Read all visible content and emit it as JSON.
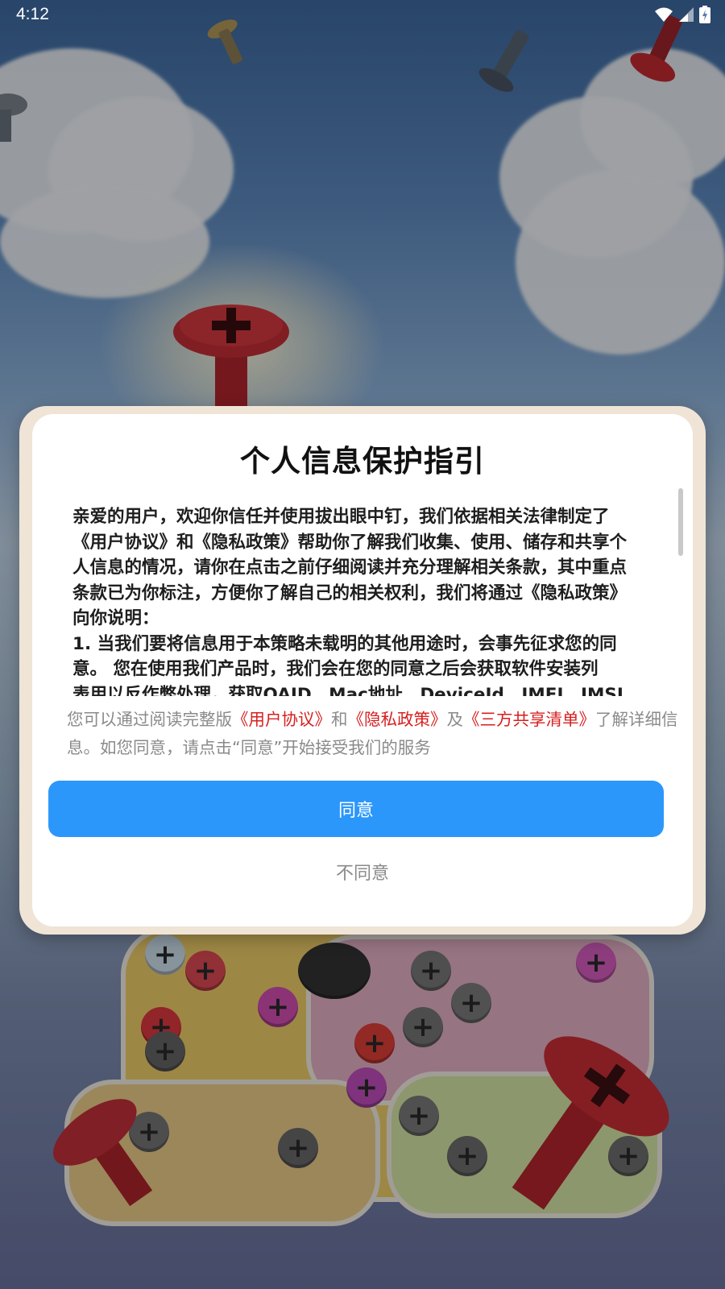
{
  "status_bar": {
    "time": "4:12",
    "icons": [
      "wifi-icon",
      "cellular-signal-icon",
      "battery-charging-icon"
    ]
  },
  "dialog": {
    "title": "个人信息保护指引",
    "terms_lines": [
      "亲爱的用户，欢迎你信任并使用拔出眼中钉，我们依据相关法律制定了",
      "《用户协议》和《隐私政策》帮助你了解我们收集、使用、储存和共享个",
      "人信息的情况，请你在点击之前仔细阅读并充分理解相关条款，其中重点",
      "条款已为你标注，方便你了解自己的相关权利，我们将通过《隐私政策》",
      "向你说明：",
      "1. 当我们要将信息用于本策略未载明的其他用途时，会事先征求您的同",
      "意。 您在使用我们产品时，我们会在您的同意之后会获取软件安装列",
      "表用以反作弊处理，获取OAID、Mac地址、DeviceId、IMEI、IMSI、"
    ],
    "summary": {
      "prefix": "您可以通过阅读完整版",
      "link_user_agreement": "《用户协议》",
      "and": "和",
      "link_privacy_policy": "《隐私政策》",
      "and2": "及",
      "link_third_party_list": "《三方共享清单》",
      "suffix": "了解详细信息。如您同意，请点击“同意”开始接受我们的服务"
    },
    "agree_label": "同意",
    "disagree_label": "不同意"
  },
  "colors": {
    "accent": "#2b97fb",
    "link": "#d71f1f",
    "dialog_frame": "#efe4d6",
    "muted_text": "#8a8a8a"
  }
}
